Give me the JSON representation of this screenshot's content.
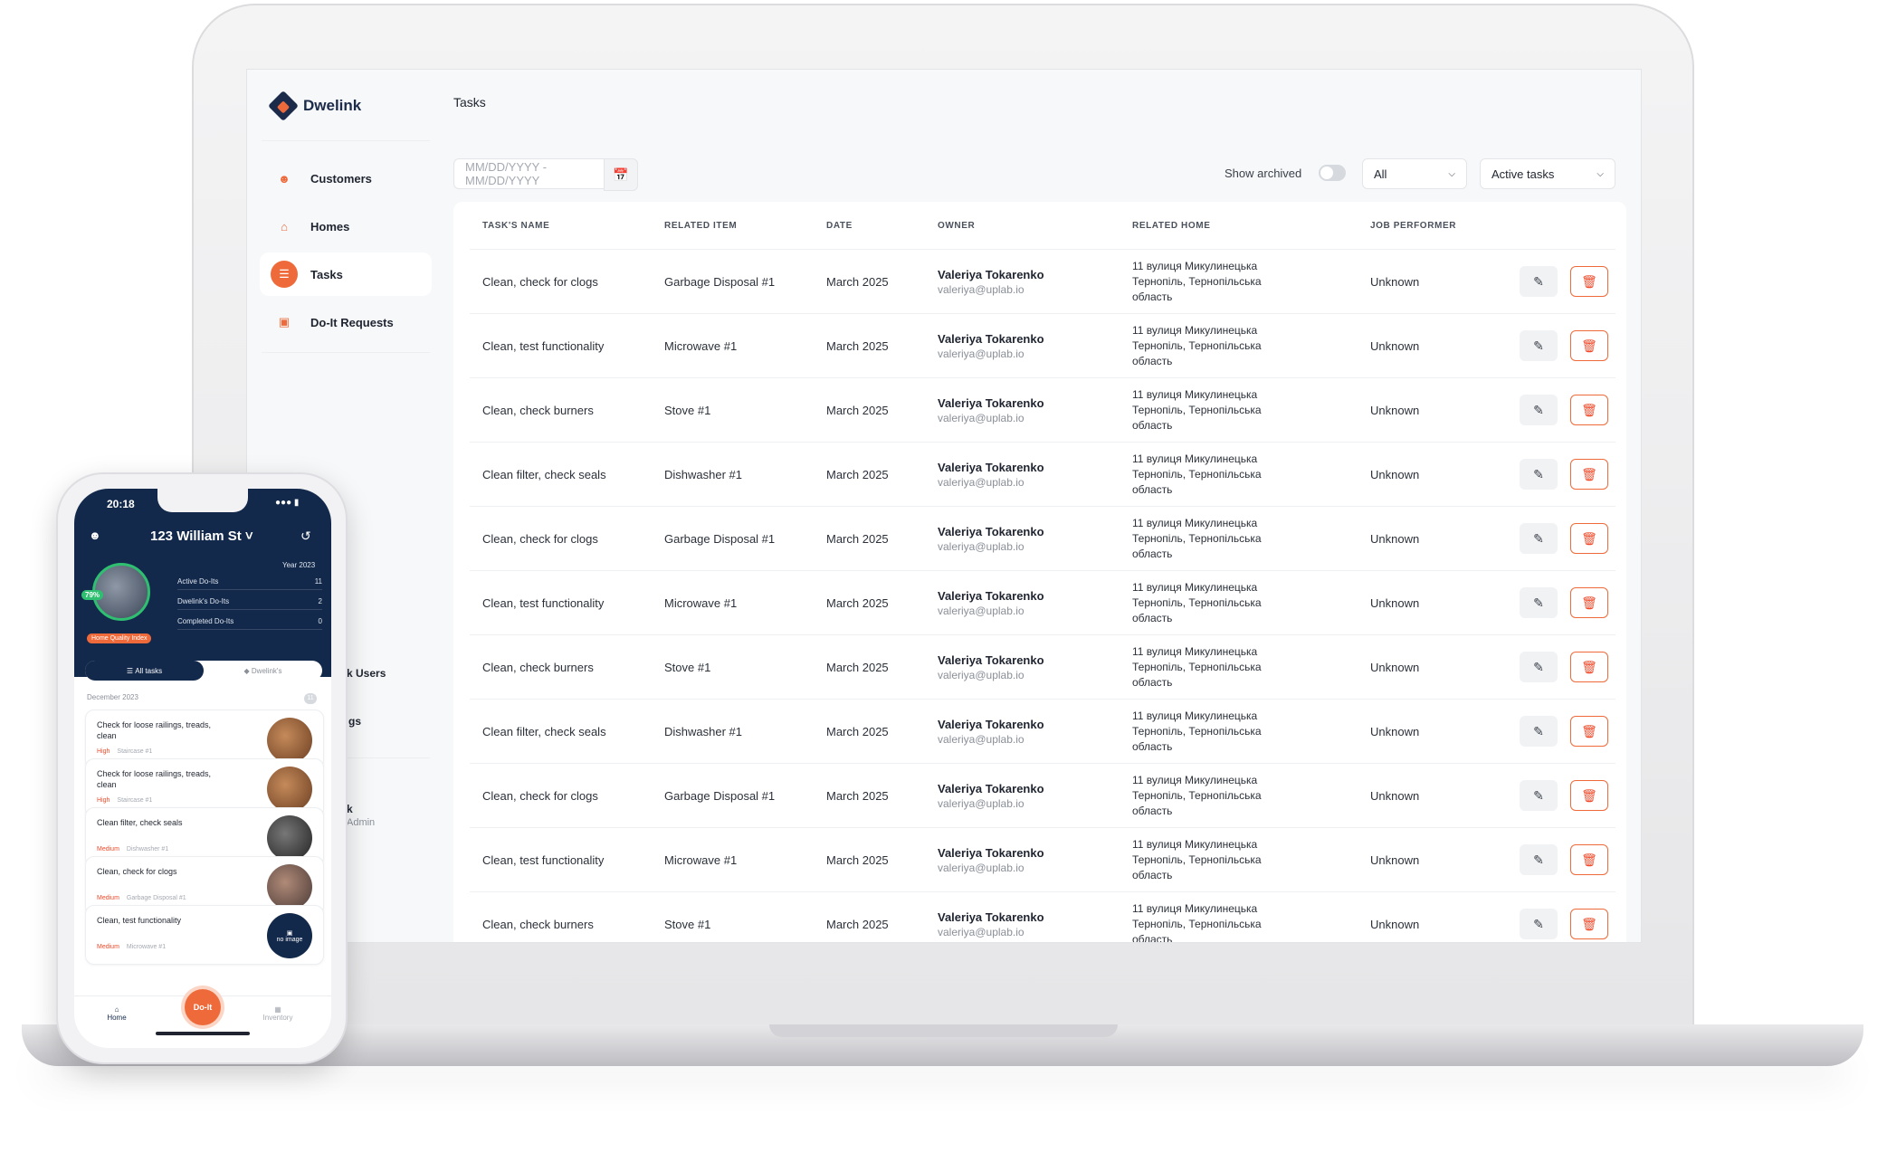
{
  "app": {
    "logo_text": "Dwelink",
    "accent": "#ef6a3a",
    "navy": "#13294b"
  },
  "sidebar": {
    "items": [
      {
        "label": "Customers",
        "icon": "user-icon"
      },
      {
        "label": "Homes",
        "icon": "home-icon"
      },
      {
        "label": "Tasks",
        "icon": "list-icon",
        "active": true
      },
      {
        "label": "Do-It Requests",
        "icon": "request-icon"
      }
    ],
    "partial_users": "k Users",
    "partial_gs": "gs",
    "partial_k": "k",
    "partial_admin": "Admin"
  },
  "main": {
    "title": "Tasks",
    "date_placeholder": "MM/DD/YYYY - MM/DD/YYYY",
    "show_archived_label": "Show archived",
    "filter_all": "All",
    "filter_active": "Active tasks",
    "columns": [
      "TASK'S NAME",
      "RELATED ITEM",
      "DATE",
      "OWNER",
      "RELATED HOME",
      "JOB PERFORMER"
    ],
    "rows": [
      {
        "task": "Clean, check for clogs",
        "item": "Garbage Disposal #1",
        "date": "March 2025",
        "owner": "Valeriya Tokarenko",
        "email": "valeriya@uplab.io",
        "home1": "11 вулиця Микулинецька",
        "home2": "Тернопіль, Тернопільська",
        "home3": "область",
        "performer": "Unknown"
      },
      {
        "task": "Clean, test functionality",
        "item": "Microwave #1",
        "date": "March 2025",
        "owner": "Valeriya Tokarenko",
        "email": "valeriya@uplab.io",
        "home1": "11 вулиця Микулинецька",
        "home2": "Тернопіль, Тернопільська",
        "home3": "область",
        "performer": "Unknown"
      },
      {
        "task": "Clean, check burners",
        "item": "Stove #1",
        "date": "March 2025",
        "owner": "Valeriya Tokarenko",
        "email": "valeriya@uplab.io",
        "home1": "11 вулиця Микулинецька",
        "home2": "Тернопіль, Тернопільська",
        "home3": "область",
        "performer": "Unknown"
      },
      {
        "task": "Clean filter, check seals",
        "item": "Dishwasher #1",
        "date": "March 2025",
        "owner": "Valeriya Tokarenko",
        "email": "valeriya@uplab.io",
        "home1": "11 вулиця Микулинецька",
        "home2": "Тернопіль, Тернопільська",
        "home3": "область",
        "performer": "Unknown"
      },
      {
        "task": "Clean, check for clogs",
        "item": "Garbage Disposal #1",
        "date": "March 2025",
        "owner": "Valeriya Tokarenko",
        "email": "valeriya@uplab.io",
        "home1": "11 вулиця Микулинецька",
        "home2": "Тернопіль, Тернопільська",
        "home3": "область",
        "performer": "Unknown"
      },
      {
        "task": "Clean, test functionality",
        "item": "Microwave #1",
        "date": "March 2025",
        "owner": "Valeriya Tokarenko",
        "email": "valeriya@uplab.io",
        "home1": "11 вулиця Микулинецька",
        "home2": "Тернопіль, Тернопільська",
        "home3": "область",
        "performer": "Unknown"
      },
      {
        "task": "Clean, check burners",
        "item": "Stove #1",
        "date": "March 2025",
        "owner": "Valeriya Tokarenko",
        "email": "valeriya@uplab.io",
        "home1": "11 вулиця Микулинецька",
        "home2": "Тернопіль, Тернопільська",
        "home3": "область",
        "performer": "Unknown"
      },
      {
        "task": "Clean filter, check seals",
        "item": "Dishwasher #1",
        "date": "March 2025",
        "owner": "Valeriya Tokarenko",
        "email": "valeriya@uplab.io",
        "home1": "11 вулиця Микулинецька",
        "home2": "Тернопіль, Тернопільська",
        "home3": "область",
        "performer": "Unknown"
      },
      {
        "task": "Clean, check for clogs",
        "item": "Garbage Disposal #1",
        "date": "March 2025",
        "owner": "Valeriya Tokarenko",
        "email": "valeriya@uplab.io",
        "home1": "11 вулиця Микулинецька",
        "home2": "Тернопіль, Тернопільська",
        "home3": "область",
        "performer": "Unknown"
      },
      {
        "task": "Clean, test functionality",
        "item": "Microwave #1",
        "date": "March 2025",
        "owner": "Valeriya Tokarenko",
        "email": "valeriya@uplab.io",
        "home1": "11 вулиця Микулинецька",
        "home2": "Тернопіль, Тернопільська",
        "home3": "область",
        "performer": "Unknown"
      },
      {
        "task": "Clean, check burners",
        "item": "Stove #1",
        "date": "March 2025",
        "owner": "Valeriya Tokarenko",
        "email": "valeriya@uplab.io",
        "home1": "11 вулиця Микулинецька",
        "home2": "Тернопіль, Тернопільська",
        "home3": "область",
        "performer": "Unknown"
      }
    ]
  },
  "phone": {
    "time": "20:18",
    "address": "123 William St",
    "year": "Year 2023",
    "score": "79%",
    "hqi_label": "Home Quality Index",
    "stats": [
      {
        "label": "Active Do-Its",
        "value": "11"
      },
      {
        "label": "Dwelink's Do-Its",
        "value": "2"
      },
      {
        "label": "Completed Do-Its",
        "value": "0"
      }
    ],
    "tab_all": "All tasks",
    "tab_dwelink": "Dwelink's",
    "month": "December 2023",
    "count": "11",
    "cards": [
      {
        "title": "Check for loose railings, treads, clean",
        "priority": "High",
        "item": "Staircase #1"
      },
      {
        "title": "Check for loose railings, treads, clean",
        "priority": "High",
        "item": "Staircase #1"
      },
      {
        "title": "Clean filter, check seals",
        "priority": "Medium",
        "item": "Dishwasher #1"
      },
      {
        "title": "Clean, check for clogs",
        "priority": "Medium",
        "item": "Garbage Disposal #1"
      },
      {
        "title": "Clean, test functionality",
        "priority": "Medium",
        "item": "Microwave #1"
      }
    ],
    "no_image": "no image",
    "nav_home": "Home",
    "nav_doit": "Do-It",
    "nav_inventory": "Inventory"
  }
}
